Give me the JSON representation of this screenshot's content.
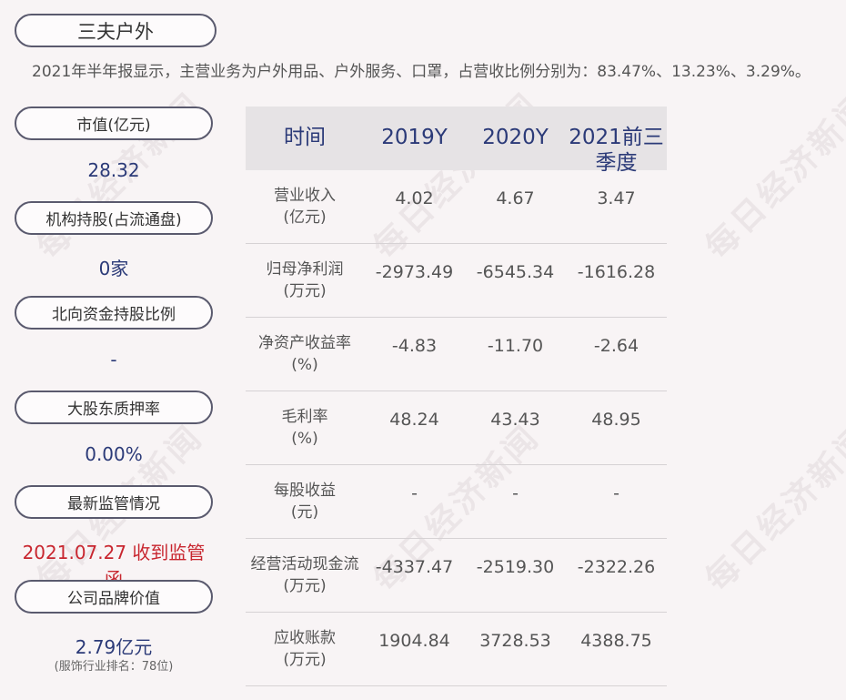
{
  "company": "三夫户外",
  "summary": "2021年半年报显示，主营业务为户外用品、户外服务、口罩，占营收比例分别为：83.47%、13.23%、3.29%。",
  "watermark": "每日经济新闻",
  "sidebar": {
    "items": [
      {
        "label": "市值(亿元)",
        "value": "28.32"
      },
      {
        "label": "机构持股(占流通盘)",
        "value": "0家"
      },
      {
        "label": "北向资金持股比例",
        "value": "-"
      },
      {
        "label": "大股东质押率",
        "value": "0.00%"
      },
      {
        "label": "最新监管情况",
        "value": "2021.07.27 收到监管函"
      },
      {
        "label": "公司品牌价值",
        "value": "2.79亿元",
        "note": "(服饰行业排名：78位)"
      }
    ]
  },
  "table": {
    "headers": [
      "时间",
      "2019Y",
      "2020Y",
      "2021前三",
      "季度"
    ],
    "rows": [
      {
        "label1": "营业收入",
        "label2": "(亿元)",
        "values": [
          "4.02",
          "4.67",
          "3.47"
        ]
      },
      {
        "label1": "归母净利润",
        "label2": "(万元)",
        "values": [
          "-2973.49",
          "-6545.34",
          "-1616.28"
        ]
      },
      {
        "label1": "净资产收益率",
        "label2": "(%)",
        "values": [
          "-4.83",
          "-11.70",
          "-2.64"
        ]
      },
      {
        "label1": "毛利率",
        "label2": "(%)",
        "values": [
          "48.24",
          "43.43",
          "48.95"
        ]
      },
      {
        "label1": "每股收益",
        "label2": "(元)",
        "values": [
          "-",
          "-",
          "-"
        ]
      },
      {
        "label1": "经营活动现金流",
        "label2": "(万元)",
        "values": [
          "-4337.47",
          "-2519.30",
          "-2322.26"
        ]
      },
      {
        "label1": "应收账款",
        "label2": "(万元)",
        "values": [
          "1904.84",
          "3728.53",
          "4388.75"
        ]
      }
    ]
  }
}
